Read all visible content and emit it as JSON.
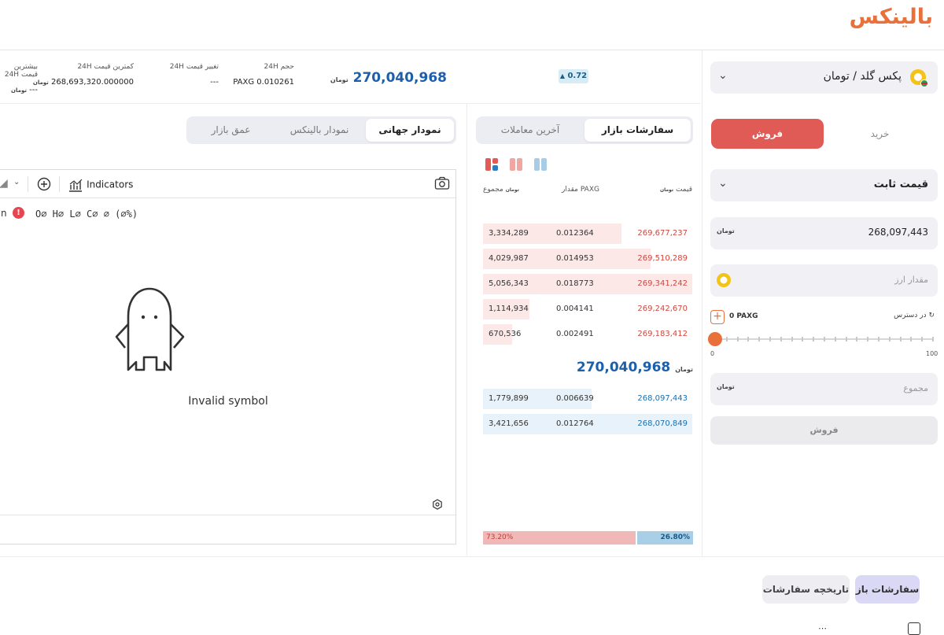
{
  "brand": {
    "logo_text": "بالینکس",
    "accent": "#e8703a"
  },
  "ticker": {
    "last_price": "270,040,968",
    "currency_label": "تومان",
    "change": "0.72",
    "change_arrow": "▲",
    "stats": [
      {
        "label": "حجم 24H",
        "value": "PAXG 0.010261"
      },
      {
        "label": "تغییر قیمت 24H",
        "value": "---"
      },
      {
        "label": "کمترین قیمت 24H",
        "value": "268,693,320.000000"
      },
      {
        "label": "بیشترین قیمت 24H",
        "value": "---"
      }
    ]
  },
  "chart_tabs": [
    "نمودار جهانی",
    "نمودار بالینکس",
    "عمق بازار"
  ],
  "chart": {
    "indicators_label": "Indicators",
    "ohlc": "O∅ H∅ L∅ C∅ ∅ (∅%)",
    "invalid_text": "Invalid symbol"
  },
  "orderbook": {
    "tabs": [
      "سفارشات بازار",
      "آخرین معاملات"
    ],
    "headers": {
      "price": "قیمت",
      "amount": "مقدار PAXG",
      "total": "مجموع"
    },
    "asks": [
      {
        "price": "269,677,237",
        "amount": "0.012364",
        "total": "3,334,289",
        "depth": 0.66
      },
      {
        "price": "269,510,289",
        "amount": "0.014953",
        "total": "4,029,987",
        "depth": 0.8
      },
      {
        "price": "269,341,242",
        "amount": "0.018773",
        "total": "5,056,343",
        "depth": 1.0
      },
      {
        "price": "269,242,670",
        "amount": "0.004141",
        "total": "1,114,934",
        "depth": 0.22
      },
      {
        "price": "269,183,412",
        "amount": "0.002491",
        "total": "670,536",
        "depth": 0.14
      }
    ],
    "mid_price": "270,040,968",
    "bids": [
      {
        "price": "268,097,443",
        "amount": "0.006639",
        "total": "1,779,899",
        "depth": 0.52
      },
      {
        "price": "268,070,849",
        "amount": "0.012764",
        "total": "3,421,656",
        "depth": 1.0
      }
    ],
    "sell_ratio": "73.20%",
    "buy_ratio": "26.80%"
  },
  "order_form": {
    "market_name": "پکس گلد / تومان",
    "buy_tab": "خرید",
    "sell_tab": "فروش",
    "order_type": "قیمت ثابت",
    "price_value": "268,097,443",
    "amount_placeholder": "مقدار ارز",
    "available_label": "در دسترس",
    "available_value": "0 PAXG",
    "slider_min": "0",
    "slider_max": "100",
    "slider_value": 0,
    "total_placeholder": "مجموع",
    "submit_label": "فروش",
    "sell_color": "#e05a56"
  },
  "bottom": {
    "tabs": [
      "سفارشات باز",
      "تاریخچه سفارشات"
    ]
  }
}
